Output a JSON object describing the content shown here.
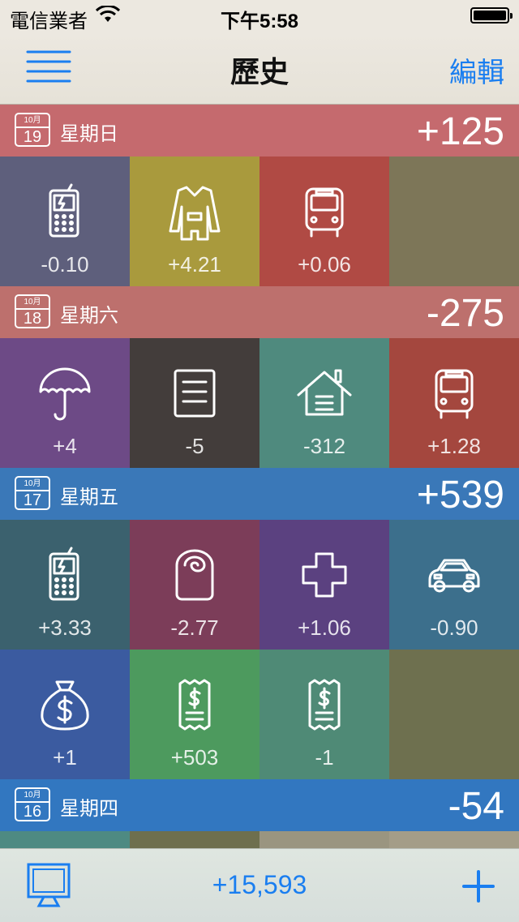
{
  "status": {
    "carrier": "電信業者",
    "time": "下午5:58"
  },
  "nav": {
    "title": "歷史",
    "edit": "編輯"
  },
  "days": [
    {
      "month": "10月",
      "day": "19",
      "weekday": "星期日",
      "total": "+125",
      "color": "#c56a6e",
      "cells": [
        {
          "icon": "phone-icon",
          "amount": "-0.10",
          "color": "#5e5f7c"
        },
        {
          "icon": "coat-icon",
          "amount": "+4.21",
          "color": "#a99a3d"
        },
        {
          "icon": "bus-icon",
          "amount": "+0.06",
          "color": "#b04a44"
        },
        {
          "icon": "",
          "amount": "",
          "color": "#7d7658"
        }
      ]
    },
    {
      "month": "10月",
      "day": "18",
      "weekday": "星期六",
      "total": "-275",
      "color": "#bd706d",
      "cells": [
        {
          "icon": "umbrella-icon",
          "amount": "+4",
          "color": "#6d4a86"
        },
        {
          "icon": "document-icon",
          "amount": "-5",
          "color": "#433d3b"
        },
        {
          "icon": "house-icon",
          "amount": "-312",
          "color": "#4f8a7e"
        },
        {
          "icon": "bus-icon",
          "amount": "+1.28",
          "color": "#a4473e"
        }
      ]
    },
    {
      "month": "10月",
      "day": "17",
      "weekday": "星期五",
      "total": "+539",
      "color": "#3a78b8",
      "cells": [
        {
          "icon": "phone-icon",
          "amount": "+3.33",
          "color": "#3b616e"
        },
        {
          "icon": "tissue-roll-icon",
          "amount": "-2.77",
          "color": "#7c3d59"
        },
        {
          "icon": "medical-cross-icon",
          "amount": "+1.06",
          "color": "#5b4180"
        },
        {
          "icon": "car-icon",
          "amount": "-0.90",
          "color": "#3c6f8c"
        },
        {
          "icon": "money-bag-icon",
          "amount": "+1",
          "color": "#3b5ba0"
        },
        {
          "icon": "receipt-icon",
          "amount": "+503",
          "color": "#4d9a5e"
        },
        {
          "icon": "receipt-icon",
          "amount": "-1",
          "color": "#4f8a76"
        },
        {
          "icon": "",
          "amount": "",
          "color": "#6e704f"
        }
      ]
    },
    {
      "month": "10月",
      "day": "16",
      "weekday": "星期四",
      "total": "-54",
      "color": "#3277c0",
      "cells": [
        {
          "icon": "",
          "amount": "",
          "color": "#4e8a82"
        },
        {
          "icon": "",
          "amount": "",
          "color": "#6e6f4e"
        },
        {
          "icon": "",
          "amount": "",
          "color": "#9a9580"
        },
        {
          "icon": "",
          "amount": "",
          "color": "#a49d88"
        }
      ]
    }
  ],
  "footer": {
    "balance": "+15,593"
  },
  "colors": {
    "accent": "#1a7ef0"
  }
}
